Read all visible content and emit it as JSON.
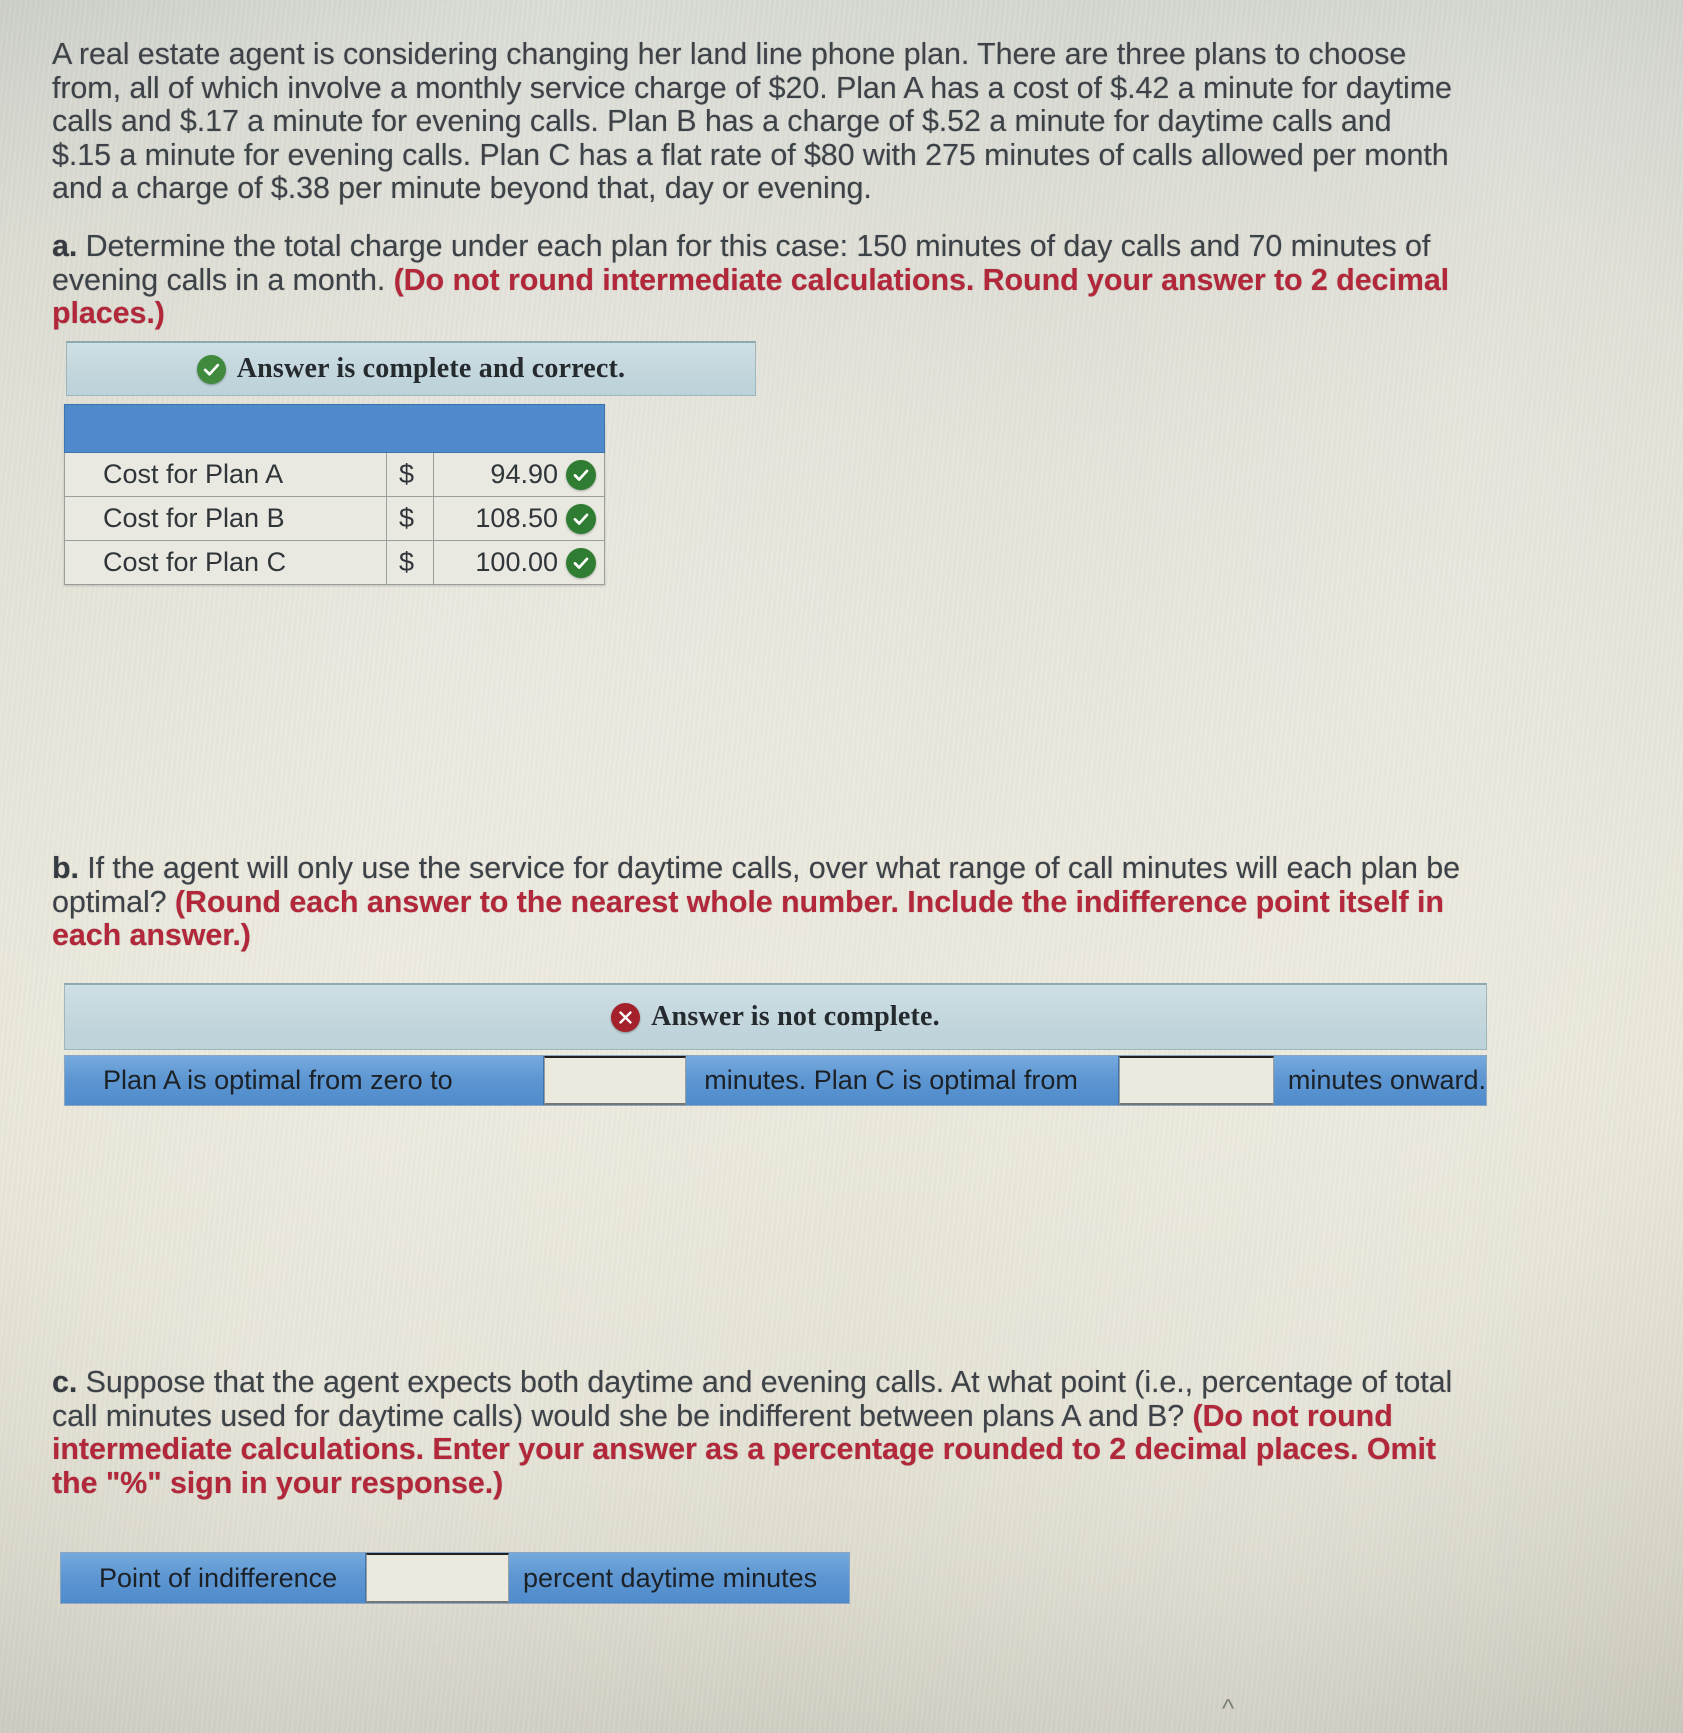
{
  "problem": {
    "intro": "A real estate agent is considering changing her land line phone plan. There are three plans to choose from, all of which involve a monthly service charge of $20. Plan A has a cost of $.42 a minute for daytime calls and $.17 a minute for evening calls. Plan B has a charge of $.52 a minute for daytime calls and $.15 a minute for evening calls. Plan C has a flat rate of $80 with 275 minutes of calls allowed per month and a charge of $.38 per minute beyond that, day or evening."
  },
  "part_a": {
    "label": "a.",
    "question": "Determine the total charge under each plan for this case: 150 minutes of day calls and 70 minutes of evening calls in a month.",
    "instruction": "(Do not round intermediate calculations. Round your answer to 2 decimal places.)",
    "status": {
      "text": "Answer is complete and correct.",
      "icon": "check-circle-icon",
      "color": "#3f8a3d"
    },
    "table": {
      "header": "",
      "rows": [
        {
          "label": "Cost for Plan A",
          "currency": "$",
          "value": "94.90",
          "mark": "correct-check-icon"
        },
        {
          "label": "Cost for Plan B",
          "currency": "$",
          "value": "108.50",
          "mark": "correct-check-icon"
        },
        {
          "label": "Cost for Plan C",
          "currency": "$",
          "value": "100.00",
          "mark": "correct-check-icon"
        }
      ]
    }
  },
  "part_b": {
    "label": "b.",
    "question": "If the agent will only use the service for daytime calls, over what range of call minutes will each plan be optimal?",
    "instruction": "(Round each answer to the nearest whole number. Include the indifference point itself in each answer.)",
    "status": {
      "text": "Answer is not complete.",
      "icon": "x-circle-icon",
      "color": "#a4202a"
    },
    "row": {
      "seg1_label": "Plan A is optimal from zero to",
      "input1_value": "",
      "seg2_label": "minutes. Plan C is optimal from",
      "input2_value": "",
      "seg3_label": "minutes onward."
    }
  },
  "part_c": {
    "label": "c.",
    "question": "Suppose that the agent expects both daytime and evening calls. At what point (i.e., percentage of total call minutes used for daytime calls) would she be indifferent between plans A and B?",
    "instruction": "(Do not round intermediate calculations.  Enter your answer as a percentage rounded to 2 decimal places.  Omit the \"%\" sign in your response.)",
    "row": {
      "seg1_label": "Point of indifference",
      "input1_value": "",
      "seg2_label": "percent daytime minutes"
    }
  },
  "colors": {
    "accent_blue": "#4f8bcc",
    "banner_blue": "#c3d7dd",
    "red_text": "#b3273b",
    "body_text": "#3c4247"
  }
}
